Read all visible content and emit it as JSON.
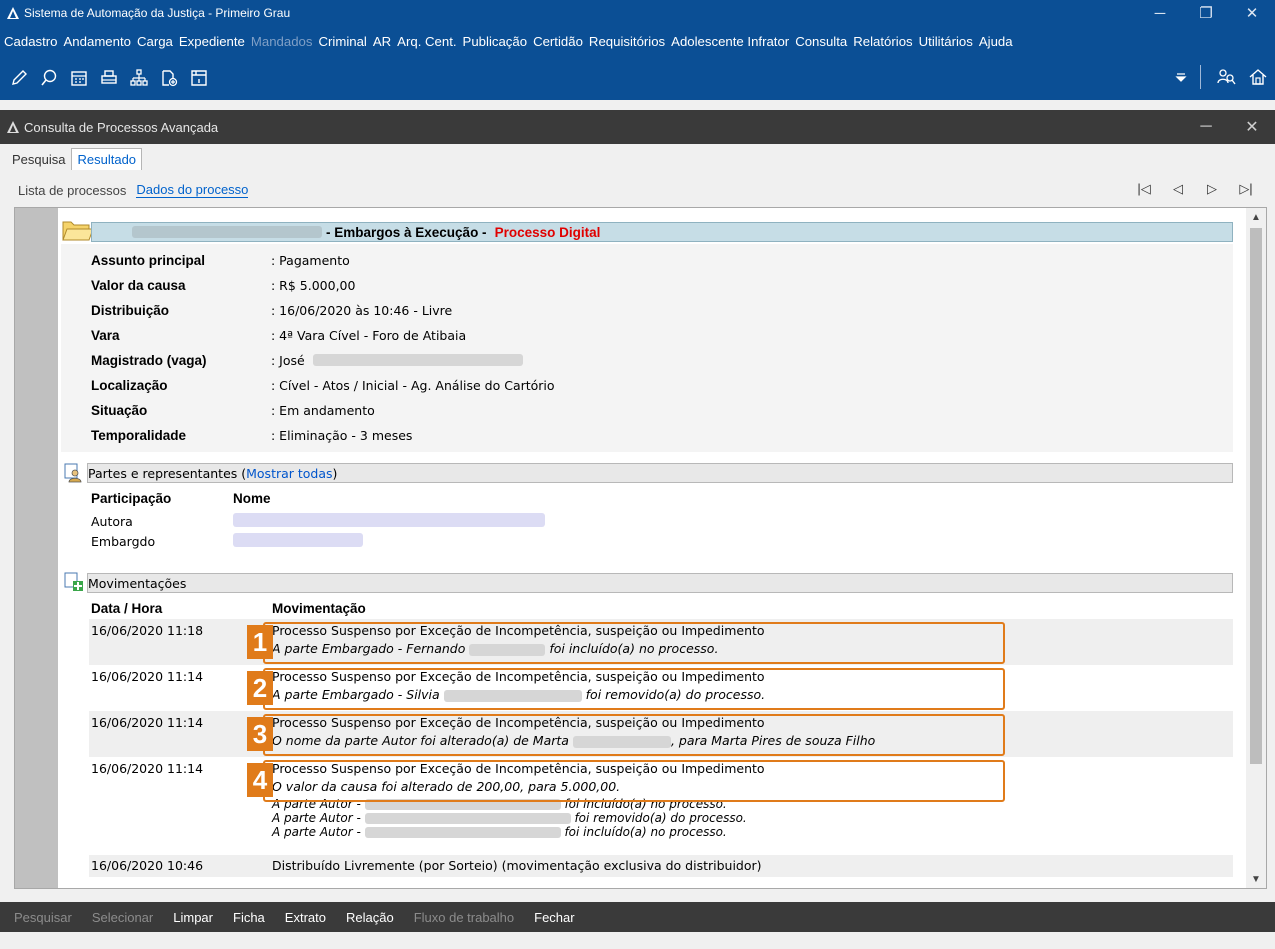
{
  "app": {
    "title": "Sistema de Automação da Justiça - Primeiro Grau",
    "menu": [
      {
        "label": "Cadastro",
        "enabled": true
      },
      {
        "label": "Andamento",
        "enabled": true
      },
      {
        "label": "Carga",
        "enabled": true
      },
      {
        "label": "Expediente",
        "enabled": true
      },
      {
        "label": "Mandados",
        "enabled": false
      },
      {
        "label": "Criminal",
        "enabled": true
      },
      {
        "label": "AR",
        "enabled": true
      },
      {
        "label": "Arq. Cent.",
        "enabled": true
      },
      {
        "label": "Publicação",
        "enabled": true
      },
      {
        "label": "Certidão",
        "enabled": true
      },
      {
        "label": "Requisitórios",
        "enabled": true
      },
      {
        "label": "Adolescente Infrator",
        "enabled": true
      },
      {
        "label": "Consulta",
        "enabled": true
      },
      {
        "label": "Relatórios",
        "enabled": true
      },
      {
        "label": "Utilitários",
        "enabled": true
      },
      {
        "label": "Ajuda",
        "enabled": true
      }
    ]
  },
  "window": {
    "title": "Consulta de Processos Avançada"
  },
  "tabs": {
    "pesquisa": "Pesquisa",
    "resultado": "Resultado"
  },
  "subtabs": {
    "lista": "Lista de processos",
    "dados": "Dados do processo"
  },
  "process": {
    "classe": "- Embargos à Execução -",
    "digital": "Processo Digital",
    "fields": [
      {
        "label": "Assunto principal",
        "value": ": Pagamento"
      },
      {
        "label": "Valor da causa",
        "value": ": R$ 5.000,00"
      },
      {
        "label": "Distribuição",
        "value": ": 16/06/2020 às 10:46 - Livre"
      },
      {
        "label": "Vara",
        "value": ": 4ª Vara Cível - Foro de Atibaia"
      },
      {
        "label": "Magistrado (vaga)",
        "value": ": José"
      },
      {
        "label": "Localização",
        "value": ": Cível - Atos / Inicial - Ag. Análise do Cartório"
      },
      {
        "label": "Situação",
        "value": ": Em andamento"
      },
      {
        "label": "Temporalidade",
        "value": ": Eliminação - 3 meses"
      }
    ]
  },
  "partes": {
    "title": "Partes e representantes (",
    "link": "Mostrar todas",
    "close": ")",
    "col_participacao": "Participação",
    "col_nome": "Nome",
    "rows": [
      "Autora",
      "Embargdo"
    ]
  },
  "movimentacoes": {
    "title": "Movimentações",
    "col_data": "Data / Hora",
    "col_mov": "Movimentação",
    "items": [
      {
        "num": "1",
        "date": "16/06/2020 11:18",
        "line1": "Processo Suspenso por Exceção de Incompetência, suspeição ou Impedimento",
        "line2a": "A parte Embargado - Fernando",
        "line2b": "foi incluído(a) no processo."
      },
      {
        "num": "2",
        "date": "16/06/2020 11:14",
        "line1": "Processo Suspenso por Exceção de Incompetência, suspeição ou Impedimento",
        "line2a": "A parte Embargado - Silvia",
        "line2b": "foi removido(a) do processo."
      },
      {
        "num": "3",
        "date": "16/06/2020 11:14",
        "line1": "Processo Suspenso por Exceção de Incompetência, suspeição ou Impedimento",
        "line2a": "O nome da parte Autor foi alterado(a) de Marta",
        "line2b": ", para Marta Pires de souza Filho"
      },
      {
        "num": "4",
        "date": "16/06/2020 11:14",
        "line1": "Processo Suspenso por Exceção de Incompetência, suspeição ou Impedimento",
        "line2a": "O valor da causa foi alterado de 200,00, para 5.000,00.",
        "line2b": ""
      }
    ],
    "extra_lines": [
      {
        "a": "A parte Autor -",
        "b": "foi incluído(a) no processo."
      },
      {
        "a": "A parte Autor -",
        "b": "foi removido(a) do processo."
      },
      {
        "a": "A parte Autor -",
        "b": "foi incluído(a) no processo."
      }
    ],
    "last": {
      "date": "16/06/2020 10:46",
      "text": "Distribuído Livremente (por Sorteio) (movimentação exclusiva do distribuidor)"
    }
  },
  "footer": [
    {
      "label": "Pesquisar",
      "enabled": false
    },
    {
      "label": "Selecionar",
      "enabled": false
    },
    {
      "label": "Limpar",
      "enabled": true
    },
    {
      "label": "Ficha",
      "enabled": true
    },
    {
      "label": "Extrato",
      "enabled": true
    },
    {
      "label": "Relação",
      "enabled": true
    },
    {
      "label": "Fluxo de trabalho",
      "enabled": false
    },
    {
      "label": "Fechar",
      "enabled": true
    }
  ],
  "colors": {
    "header_blue": "#0b4f95",
    "highlight_orange": "#e07b1a",
    "digital_red": "#e00000",
    "link_blue": "#0055cc"
  }
}
